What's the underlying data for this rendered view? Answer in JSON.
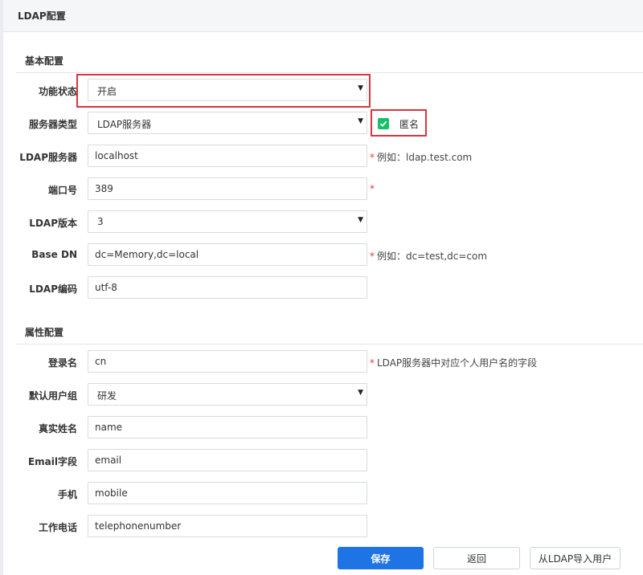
{
  "panel": {
    "title": "LDAP配置"
  },
  "sections": {
    "basic": "基本配置",
    "attributes": "属性配置"
  },
  "basic": {
    "status": {
      "label": "功能状态",
      "value": "开启"
    },
    "server_type": {
      "label": "服务器类型",
      "value": "LDAP服务器",
      "anonymous_label": "匿名",
      "anonymous_checked": true
    },
    "server": {
      "label": "LDAP服务器",
      "value": "localhost",
      "required": "*",
      "hint": "例如：ldap.test.com"
    },
    "port": {
      "label": "端口号",
      "value": "389",
      "required": "*"
    },
    "version": {
      "label": "LDAP版本",
      "value": "3"
    },
    "base_dn": {
      "label": "Base DN",
      "value": "dc=Memory,dc=local",
      "required": "*",
      "hint": "例如：dc=test,dc=com"
    },
    "encoding": {
      "label": "LDAP编码",
      "value": "utf-8"
    }
  },
  "attributes": {
    "login_name": {
      "label": "登录名",
      "value": "cn",
      "required": "*",
      "hint": "LDAP服务器中对应个人用户名的字段"
    },
    "default_group": {
      "label": "默认用户组",
      "value": "研发"
    },
    "real_name": {
      "label": "真实姓名",
      "value": "name"
    },
    "email": {
      "label": "Email字段",
      "value": "email"
    },
    "mobile": {
      "label": "手机",
      "value": "mobile"
    },
    "phone": {
      "label": "工作电话",
      "value": "telephonenumber"
    }
  },
  "buttons": {
    "save": "保存",
    "back": "返回",
    "import": "从LDAP导入用户"
  },
  "colors": {
    "primary": "#1e74e5",
    "checkbox": "#19be6b",
    "highlight": "#d9363e",
    "required": "#e4393c"
  }
}
